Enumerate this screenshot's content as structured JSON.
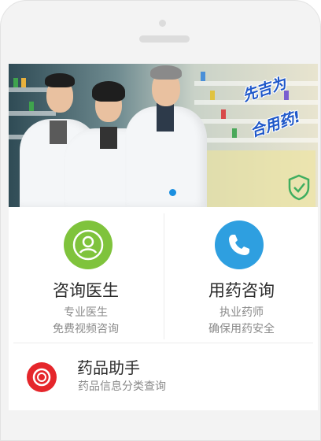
{
  "banner": {
    "slogan_line1": "先吉为",
    "slogan_line2": "合用药!",
    "active_slide": 1
  },
  "services": [
    {
      "title": "咨询医生",
      "sub1": "专业医生",
      "sub2": "免费视频咨询",
      "icon": "doctor-icon",
      "color": "#7fc33c"
    },
    {
      "title": "用药咨询",
      "sub1": "执业药师",
      "sub2": "确保用药安全",
      "icon": "phone-icon",
      "color": "#2e9fe0"
    }
  ],
  "drug_helper": {
    "title": "药品助手",
    "sub": "药品信息分类查询",
    "icon": "target-icon",
    "color": "#e5262b"
  }
}
